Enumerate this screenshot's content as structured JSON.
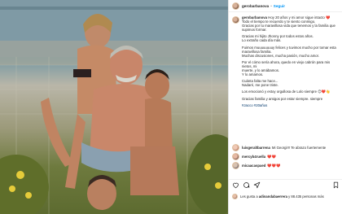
{
  "post": {
    "username": "gerobarbanova",
    "separator": "•",
    "follow_label": "Seguir"
  },
  "caption": {
    "username": "gerobarbanova",
    "lines": [
      "Hoy 20 años y mi amor sigue intacto ❤️",
      "Todo el tiempo te recuerdo y te siento conmigo.",
      "Gracias por tu maravillosa vida que tenemos y la familia que",
      "supimos formar."
    ],
    "paragraph2": [
      "Gracias mi hijito Jhonny por todos estos años.",
      "Lo extraño cada día más."
    ],
    "paragraph3": [
      "Fuimos muuuuuuuuy felices y tuvimos mucho por tomar esta",
      "maravillosa familia.",
      "Muchas discusiones, mucha pasión, mucho amor."
    ],
    "paragraph4": [
      "Por el cómo sería ahora, quedo en viejo cabrón para mis nietos, mi",
      "muerte, y lo amábamos.",
      "Y lo amamos."
    ],
    "paragraph5": [
      "Cuánta falta me hace...",
      "Nadaré, me pone triste."
    ],
    "paragraph6": [
      "Los emocionó y estoy orgullosa de Lolo siempre 😊❤️👋"
    ],
    "paragraph7": [
      "Gracias familia y amigos por estar siempre. siempre"
    ],
    "hashtags": "#Jacco #20años"
  },
  "comments": [
    {
      "username": "luisgeraltbarrena",
      "text": "Mi Georgi!!! Te abrazo fuertemente"
    },
    {
      "username": "mercyb4ruella",
      "text": "❤️❤️"
    },
    {
      "username": "micaacaspaed",
      "text": "❤️❤️❤️"
    }
  ],
  "actions": {
    "like_icon": "heart-outline-icon",
    "comment_icon": "comment-icon",
    "share_icon": "paper-plane-icon",
    "save_icon": "bookmark-icon"
  },
  "likes": {
    "prefix": "Les gusta a",
    "user": "adinandabaerrera",
    "suffix": "y 88.435 personas más"
  },
  "colors": {
    "link": "#0095f6",
    "heart": "#d12a2a"
  }
}
